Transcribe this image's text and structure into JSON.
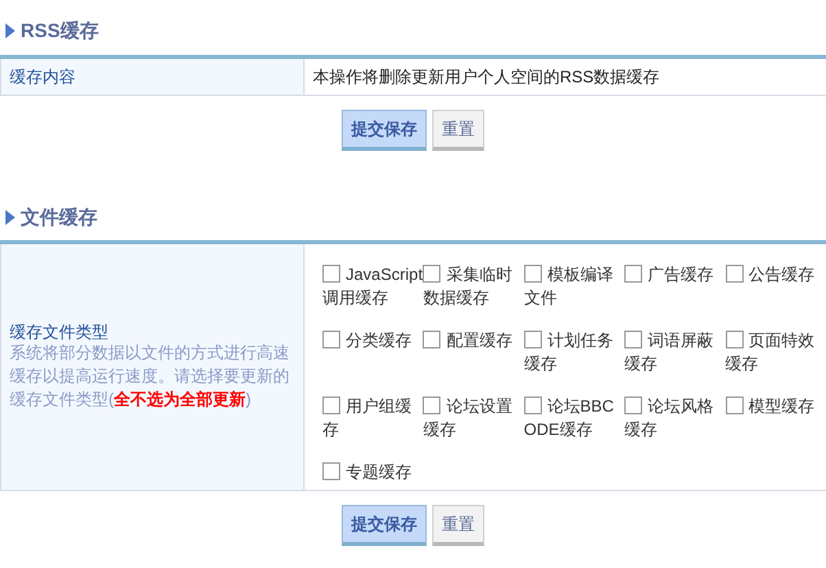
{
  "rss_section": {
    "title": "RSS缓存",
    "row": {
      "label": "缓存内容",
      "value": "本操作将删除更新用户个人空间的RSS数据缓存"
    },
    "buttons": [
      {
        "label": "提交保存",
        "kind": "primary"
      },
      {
        "label": "重置",
        "kind": "secondary"
      }
    ]
  },
  "file_section": {
    "title": "文件缓存",
    "label": "缓存文件类型",
    "description": "系统将部分数据以文件的方式进行高速缓存以提高运行速度。请选择要更新的缓存文件类型(**全不选为全部更新**)",
    "options": [
      {
        "label": "JavaScript调用缓存",
        "checked": false
      },
      {
        "label": "采集临时数据缓存",
        "checked": false
      },
      {
        "label": "模板编译文件",
        "checked": false
      },
      {
        "label": "广告缓存",
        "checked": false
      },
      {
        "label": "公告缓存",
        "checked": false
      },
      {
        "label": "分类缓存",
        "checked": false
      },
      {
        "label": "配置缓存",
        "checked": false
      },
      {
        "label": "计划任务缓存",
        "checked": false
      },
      {
        "label": "词语屏蔽缓存",
        "checked": false
      },
      {
        "label": "页面特效缓存",
        "checked": false
      },
      {
        "label": "用户组缓存",
        "checked": false
      },
      {
        "label": "论坛设置缓存",
        "checked": false
      },
      {
        "label": "论坛BBCODE缓存",
        "checked": false
      },
      {
        "label": "论坛风格缓存",
        "checked": false
      },
      {
        "label": "模型缓存",
        "checked": false
      },
      {
        "label": "专题缓存",
        "checked": false
      }
    ],
    "buttons": [
      {
        "label": "提交保存",
        "kind": "primary"
      },
      {
        "label": "重置",
        "kind": "secondary"
      }
    ]
  }
}
